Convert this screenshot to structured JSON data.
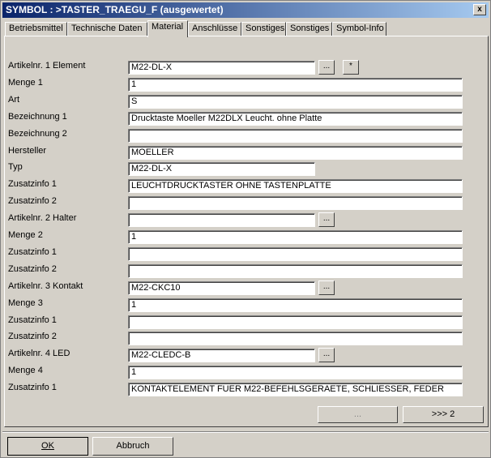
{
  "window": {
    "title": "SYMBOL : >TASTER_TRAEGU_F  (ausgewertet)",
    "close_glyph": "x"
  },
  "tabs": [
    {
      "label": "Betriebsmittel"
    },
    {
      "label": "Technische Daten"
    },
    {
      "label": "Material",
      "active": true
    },
    {
      "label": "Anschlüsse"
    },
    {
      "label": "Sonstiges"
    },
    {
      "label": "Sonstiges"
    },
    {
      "label": "Symbol-Info"
    }
  ],
  "rows": [
    {
      "label": "Artikelnr. 1 Element",
      "value": "M22-DL-X",
      "has_browse": true,
      "has_clear": true
    },
    {
      "label": "Menge 1",
      "value": "1"
    },
    {
      "label": "Art",
      "value": "S"
    },
    {
      "label": "Bezeichnung 1",
      "value": "Drucktaste Moeller M22DLX  Leucht. ohne Platte"
    },
    {
      "label": "Bezeichnung 2",
      "value": ""
    },
    {
      "label": "Hersteller",
      "value": "MOELLER"
    },
    {
      "label": "Typ",
      "value": "M22-DL-X"
    },
    {
      "label": "Zusatzinfo 1",
      "value": "LEUCHTDRUCKTASTER OHNE TASTENPLATTE"
    },
    {
      "label": "Zusatzinfo 2",
      "value": ""
    },
    {
      "label": "Artikelnr. 2 Halter",
      "value": "",
      "has_browse": true
    },
    {
      "label": "Menge 2",
      "value": "1"
    },
    {
      "label": "Zusatzinfo 1",
      "value": ""
    },
    {
      "label": "Zusatzinfo 2",
      "value": ""
    },
    {
      "label": "Artikelnr. 3 Kontakt",
      "value": "M22-CKC10",
      "has_browse": true
    },
    {
      "label": "Menge 3",
      "value": "1"
    },
    {
      "label": "Zusatzinfo 1",
      "value": ""
    },
    {
      "label": "Zusatzinfo 2",
      "value": ""
    },
    {
      "label": "Artikelnr. 4 LED",
      "value": "M22-CLEDC-B",
      "has_browse": true
    },
    {
      "label": "Menge 4",
      "value": "1"
    },
    {
      "label": "Zusatzinfo 1",
      "value": "KONTAKTELEMENT FUER M22-BEFEHLSGERAETE, SCHLIESSER,  FEDER"
    }
  ],
  "buttons": {
    "browse_label": "...",
    "clear_label": "*",
    "prev_label": "...",
    "next_label": ">>> 2",
    "ok_label": "OK",
    "cancel_label": "Abbruch"
  }
}
